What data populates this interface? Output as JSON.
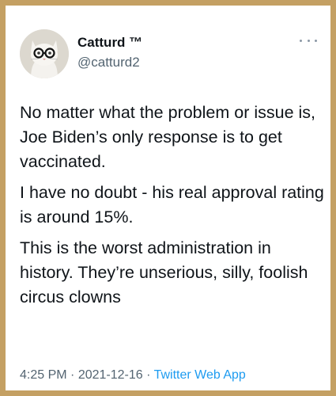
{
  "author": {
    "display_name": "Catturd ™",
    "handle": "@catturd2",
    "avatar_icon": "cat-with-glasses-icon"
  },
  "tweet": {
    "paragraphs": [
      "No matter what the problem or issue is, Joe Biden’s only response is to get vaccinated.",
      "I have no doubt - his real approval rating is around 15%.",
      "This is the worst administration in history. They’re unserious, silly, foolish circus clowns"
    ],
    "time": "4:25 PM",
    "date": "2021-12-16",
    "source": "Twitter Web App",
    "separator": "·"
  },
  "colors": {
    "frame": "#c4a063",
    "text": "#0f1419",
    "secondary_text": "#536471",
    "link": "#1d9bf0"
  },
  "icons": {
    "more": "more-options-icon"
  }
}
